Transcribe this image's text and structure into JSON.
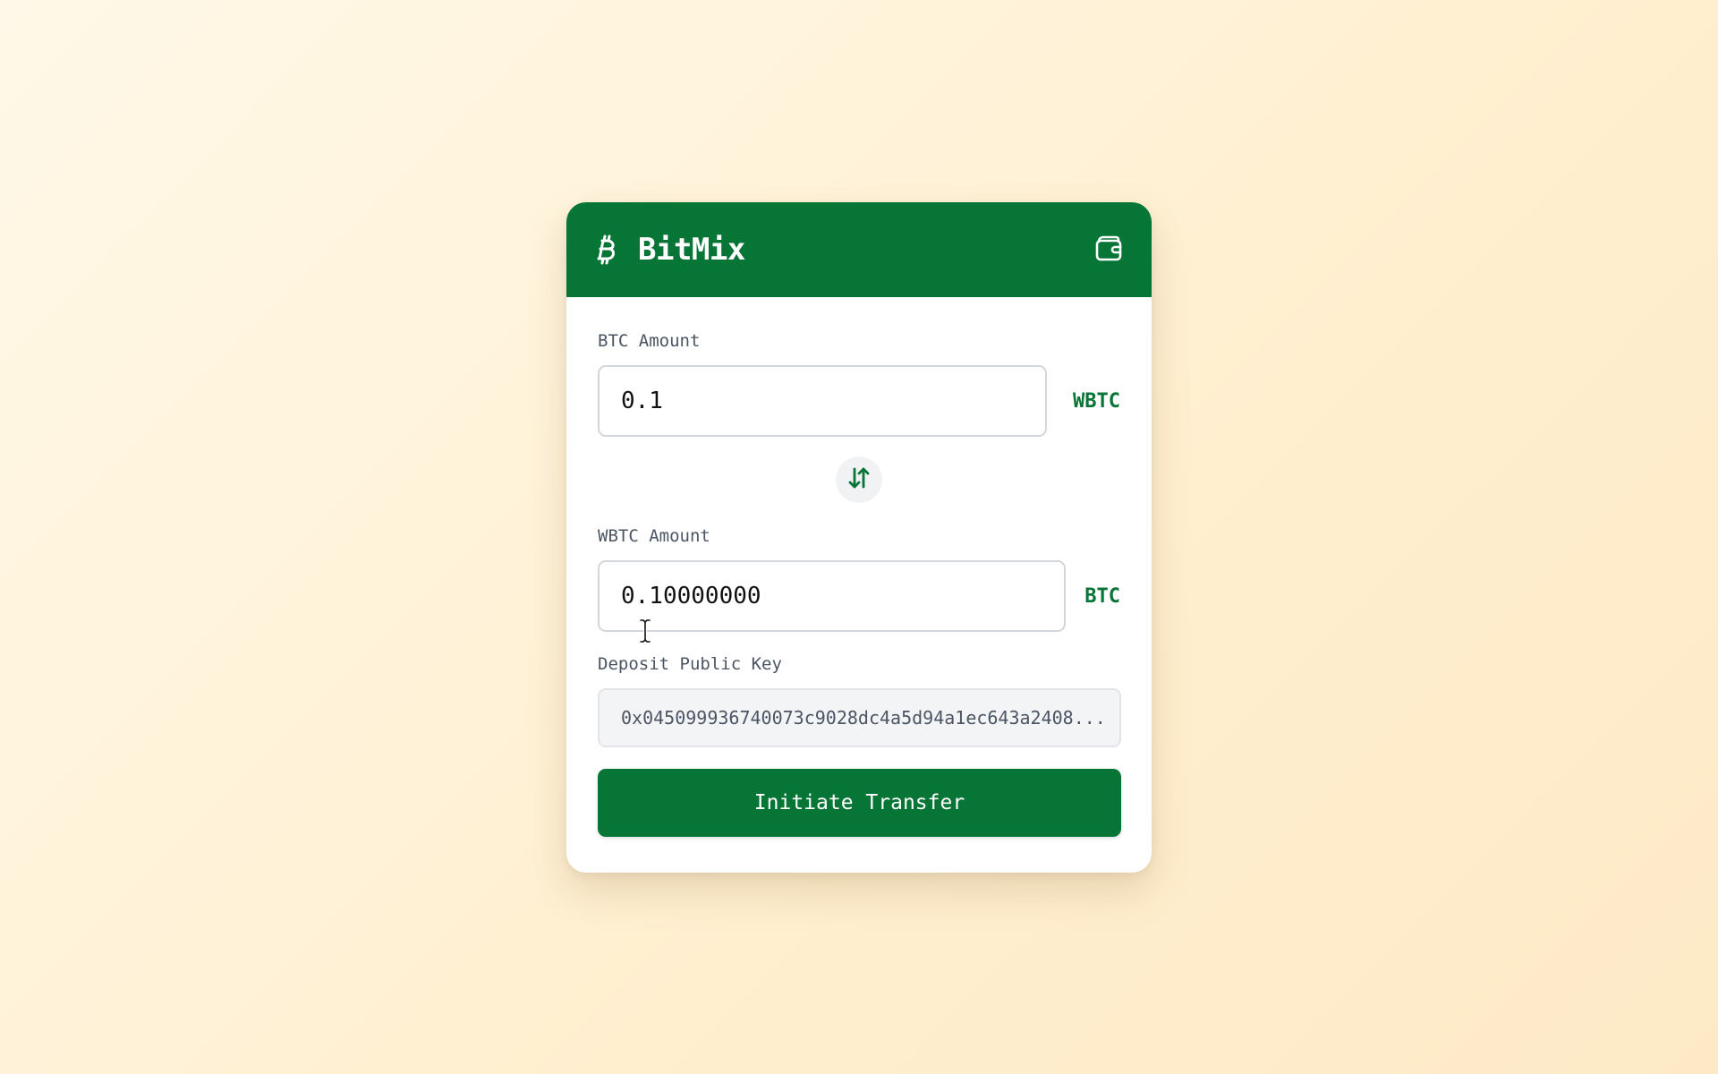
{
  "app": {
    "title": "BitMix",
    "icons": {
      "logo": "bitcoin-icon",
      "wallet": "wallet-icon",
      "swap": "swap-arrows-icon"
    },
    "colors": {
      "brand": "#077535",
      "card": "#ffffff",
      "muted_text": "#4b5563"
    }
  },
  "form": {
    "btc": {
      "label": "BTC Amount",
      "value": "0.1",
      "unit": "WBTC"
    },
    "wbtc": {
      "label": "WBTC Amount",
      "value": "0.10000000",
      "unit": "BTC"
    },
    "pubkey": {
      "label": "Deposit Public Key",
      "value": "0x045099936740073c9028dc4a5d94a1ec643a2408..."
    },
    "submit_label": "Initiate Transfer"
  }
}
